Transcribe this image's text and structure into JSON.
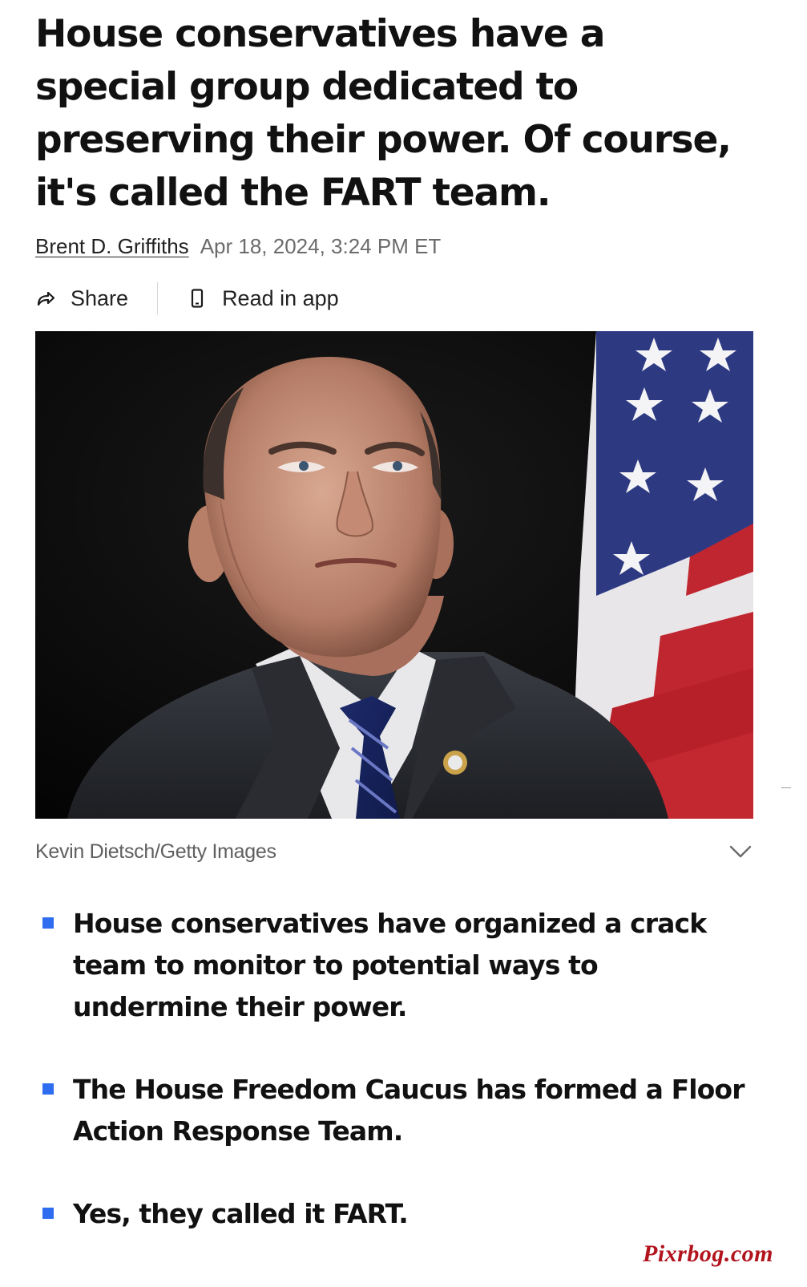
{
  "article": {
    "headline": "House conservatives have a special group dedicated to preserving their power. Of course, it's called the FART team.",
    "author": "Brent D. Griffiths",
    "published": "Apr 18, 2024, 3:24 PM ET"
  },
  "actions": {
    "share_label": "Share",
    "share_icon": "share-arrow-icon",
    "read_in_app_label": "Read in app",
    "read_in_app_icon": "phone-icon"
  },
  "photo": {
    "credit": "Kevin Dietsch/Getty Images",
    "toggle_icon": "chevron-down-icon"
  },
  "key_points": [
    "House conservatives have organized a crack team to monitor to potential ways to undermine their power.",
    "The House Freedom Caucus has formed a Floor Action Response Team.",
    "Yes, they called it FART."
  ],
  "watermark": "Pixrbog.com",
  "colors": {
    "bullet_marker": "#2e6cf0",
    "watermark": "#b2141d",
    "meta_gray": "#6b6b6b"
  }
}
